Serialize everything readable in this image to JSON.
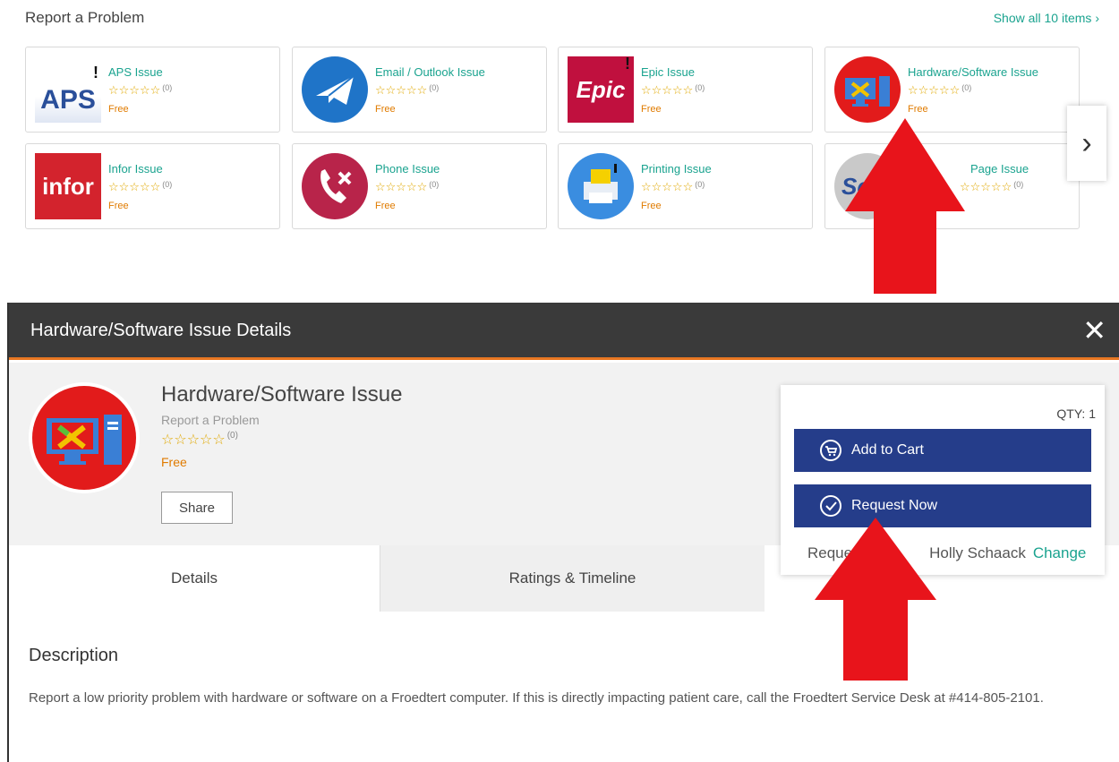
{
  "catalog": {
    "title": "Report a Problem",
    "show_all": "Show all 10 items",
    "show_all_chevron": "›",
    "next_chevron": "›",
    "items": [
      {
        "name": "APS Issue",
        "logo_text": "APS",
        "stars": "☆☆☆☆☆",
        "count": "(0)",
        "price": "Free"
      },
      {
        "name": "Email / Outlook Issue",
        "stars": "☆☆☆☆☆",
        "count": "(0)",
        "price": "Free"
      },
      {
        "name": "Epic Issue",
        "logo_text": "Epic",
        "stars": "☆☆☆☆☆",
        "count": "(0)",
        "price": "Free"
      },
      {
        "name": "Hardware/Software Issue",
        "stars": "☆☆☆☆☆",
        "count": "(0)",
        "price": "Free"
      },
      {
        "name": "Infor Issue",
        "logo_text": "infor",
        "stars": "☆☆☆☆☆",
        "count": "(0)",
        "price": "Free"
      },
      {
        "name": "Phone Issue",
        "stars": "☆☆☆☆☆",
        "count": "(0)",
        "price": "Free"
      },
      {
        "name": "Printing Issue",
        "stars": "☆☆☆☆☆",
        "count": "(0)",
        "price": "Free"
      },
      {
        "name": "Page Issue",
        "logo_text": "Sc",
        "stars": "☆☆☆☆☆",
        "count": "(0)",
        "price": ""
      }
    ]
  },
  "modal": {
    "title": "Hardware/Software Issue Details",
    "close": "✕",
    "item_name": "Hardware/Software Issue",
    "category": "Report a Problem",
    "stars": "☆☆☆☆☆",
    "rating_count": "(0)",
    "price": "Free",
    "share": "Share",
    "qty": "QTY: 1",
    "add_to_cart": "Add to Cart",
    "request_now": "Request Now",
    "requester_prefix": "Reque",
    "requester_name": "Holly Schaack",
    "change": "Change",
    "tabs": [
      "Details",
      "Ratings & Timeline"
    ],
    "description_heading": "Description",
    "description_text": "Report a low priority problem with hardware or software on a Froedtert computer. If this is directly impacting patient care, call the Froedtert Service Desk at #414-805-2101."
  },
  "colors": {
    "accent_teal": "#1aa38f",
    "price_orange": "#e07b00",
    "button_blue": "#253d8a",
    "header_dark": "#3a3a3a",
    "arrow_red": "#e8141b"
  }
}
